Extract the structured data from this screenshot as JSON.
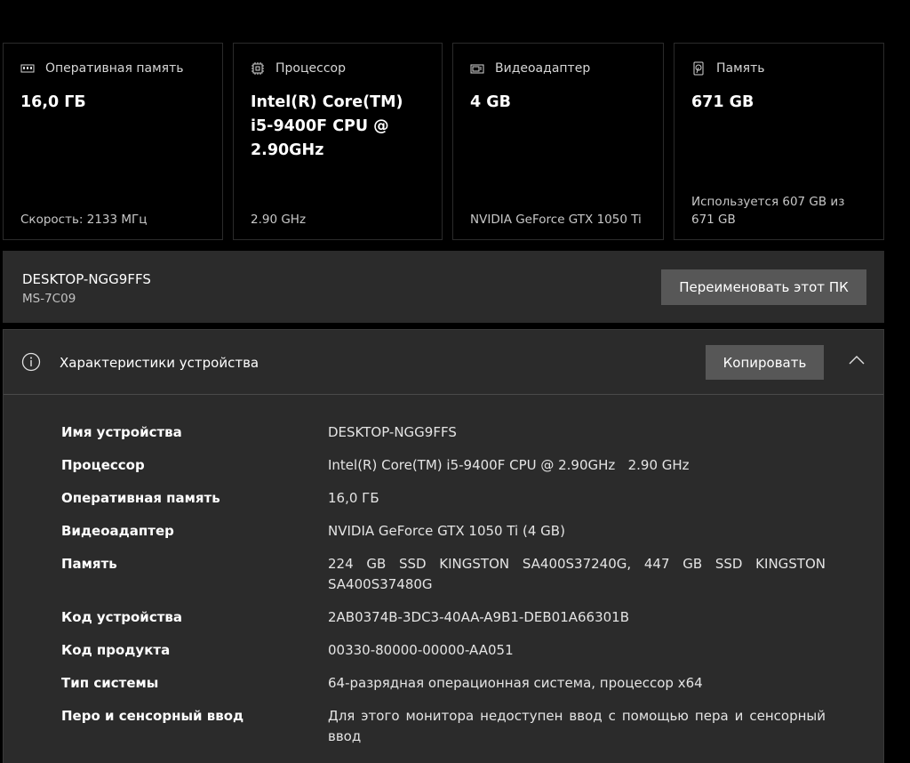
{
  "cards": [
    {
      "title": "Оперативная память",
      "value": "16,0 ГБ",
      "footer": "Скорость: 2133 МГц",
      "icon": "ram-icon"
    },
    {
      "title": "Процессор",
      "value": "Intel(R) Core(TM) i5-9400F CPU @ 2.90GHz",
      "footer": "2.90 GHz",
      "icon": "processor-icon"
    },
    {
      "title": "Видеоадаптер",
      "value": "4 GB",
      "footer": "NVIDIA GeForce GTX 1050 Ti",
      "icon": "gpu-icon"
    },
    {
      "title": "Память",
      "value": "671 GB",
      "footer": "Используется 607 GB из 671 GB",
      "icon": "storage-icon"
    }
  ],
  "device": {
    "name": "DESKTOP-NGG9FFS",
    "model": "MS-7C09",
    "rename_label": "Переименовать этот ПК"
  },
  "specs": {
    "title": "Характеристики устройства",
    "copy_label": "Копировать",
    "rows": [
      {
        "label": "Имя устройства",
        "value": "DESKTOP-NGG9FFS"
      },
      {
        "label": "Процессор",
        "value": "Intel(R) Core(TM) i5-9400F CPU @ 2.90GHz   2.90 GHz"
      },
      {
        "label": "Оперативная память",
        "value": "16,0 ГБ"
      },
      {
        "label": "Видеоадаптер",
        "value": "NVIDIA GeForce GTX 1050 Ti (4 GB)"
      },
      {
        "label": "Память",
        "value": "224 GB SSD KINGSTON SA400S37240G, 447 GB SSD KINGSTON SA400S37480G"
      },
      {
        "label": "Код устройства",
        "value": "2AB0374B-3DC3-40AA-A9B1-DEB01A66301B"
      },
      {
        "label": "Код продукта",
        "value": "00330-80000-00000-AA051"
      },
      {
        "label": "Тип системы",
        "value": "64-разрядная операционная система, процессор x64"
      },
      {
        "label": "Перо и сенсорный ввод",
        "value": "Для этого монитора недоступен ввод с помощью пера и сенсорный ввод"
      }
    ]
  },
  "colors": {
    "background": "#000000",
    "panel": "#2b2b2b",
    "button": "#575757"
  }
}
